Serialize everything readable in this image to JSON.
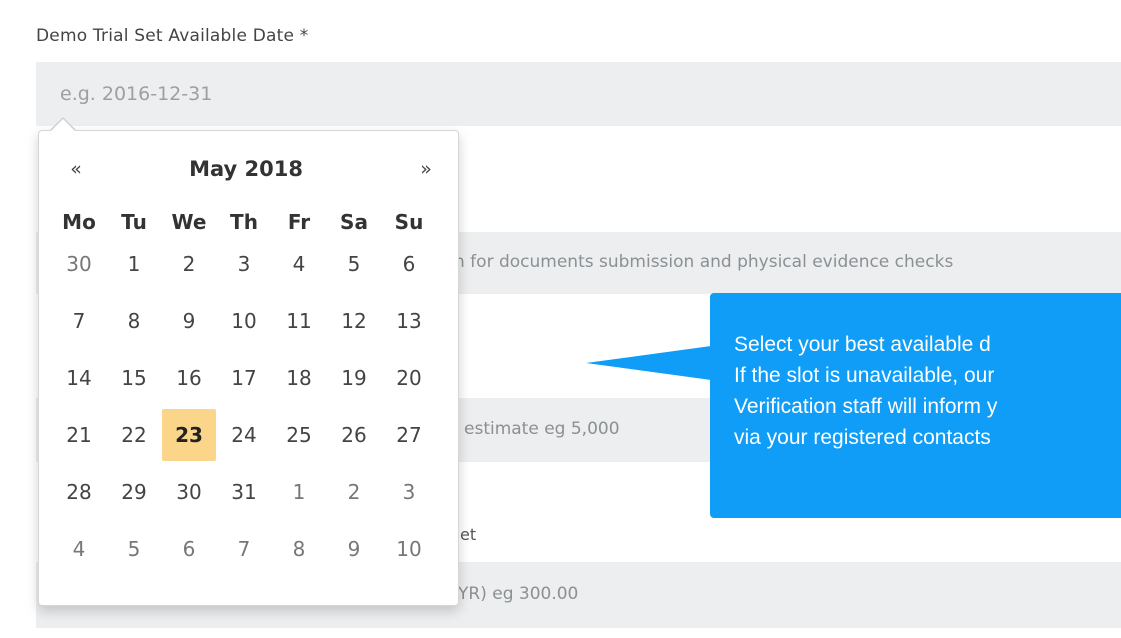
{
  "field": {
    "label": "Demo Trial Set Available Date *",
    "placeholder": "e.g. 2016-12-31"
  },
  "background_fields": {
    "documents_text": "n for documents submission and physical evidence checks",
    "estimate_text": "estimate  eg 5,000",
    "label_fragment": "et",
    "amount_text": "YR) eg 300.00"
  },
  "datepicker": {
    "prev_label": "«",
    "next_label": "»",
    "title": "May 2018",
    "days_of_week": [
      "Mo",
      "Tu",
      "We",
      "Th",
      "Fr",
      "Sa",
      "Su"
    ],
    "weeks": [
      [
        "30",
        "1",
        "2",
        "3",
        "4",
        "5",
        "6"
      ],
      [
        "7",
        "8",
        "9",
        "10",
        "11",
        "12",
        "13"
      ],
      [
        "14",
        "15",
        "16",
        "17",
        "18",
        "19",
        "20"
      ],
      [
        "21",
        "22",
        "23",
        "24",
        "25",
        "26",
        "27"
      ],
      [
        "28",
        "29",
        "30",
        "31",
        "1",
        "2",
        "3"
      ],
      [
        "4",
        "5",
        "6",
        "7",
        "8",
        "9",
        "10"
      ]
    ],
    "selected_day": "23",
    "selected_color": "#fad58a"
  },
  "callout": {
    "color": "#0f9df7",
    "lines": [
      "Select your best available d",
      "If the slot is unavailable, our",
      "Verification staff will inform y",
      "via your registered contacts"
    ]
  }
}
